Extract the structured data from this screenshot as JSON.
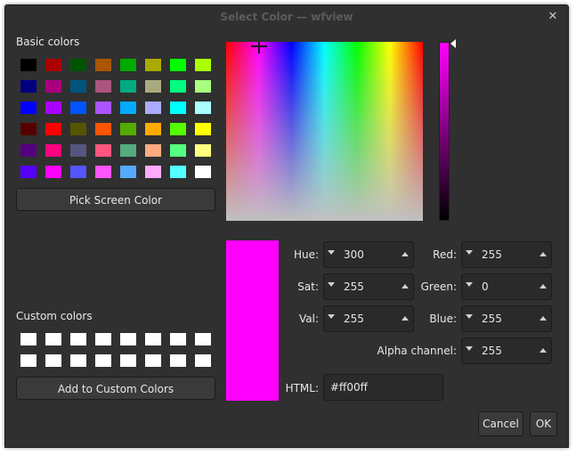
{
  "window": {
    "title": "Select Color — wfview",
    "close_glyph": "✕"
  },
  "basic_colors": {
    "label": "Basic colors",
    "swatches": [
      [
        "#000000",
        "#aa0000",
        "#005500",
        "#aa5500",
        "#00aa00",
        "#aaaa00",
        "#00ff00",
        "#aaff00"
      ],
      [
        "#00007f",
        "#aa007f",
        "#00557f",
        "#aa557f",
        "#00aa7f",
        "#aaaa7f",
        "#00ff7f",
        "#aaff7f"
      ],
      [
        "#0000ff",
        "#aa00ff",
        "#0055ff",
        "#aa55ff",
        "#00aaff",
        "#aaaaff",
        "#00ffff",
        "#aaffff"
      ],
      [
        "#550000",
        "#ff0000",
        "#555500",
        "#ff5500",
        "#55aa00",
        "#ffaa00",
        "#55ff00",
        "#ffff00"
      ],
      [
        "#55007f",
        "#ff007f",
        "#55557f",
        "#ff557f",
        "#55aa7f",
        "#ffaa7f",
        "#55ff7f",
        "#ffff7f"
      ],
      [
        "#5500ff",
        "#ff00ff",
        "#5555ff",
        "#ff55ff",
        "#55aaff",
        "#ffaaff",
        "#55ffff",
        "#ffffff"
      ]
    ]
  },
  "pick_screen_label": "Pick Screen Color",
  "custom_colors": {
    "label": "Custom colors",
    "rows": 2,
    "cols": 8,
    "color": "#ffffff"
  },
  "add_custom_label": "Add to Custom Colors",
  "current_color": "#ff00ff",
  "fields": {
    "hue": {
      "label": "Hue:",
      "value": "300"
    },
    "sat": {
      "label": "Sat:",
      "value": "255"
    },
    "val": {
      "label": "Val:",
      "value": "255"
    },
    "red": {
      "label": "Red:",
      "value": "255"
    },
    "green": {
      "label": "Green:",
      "value": "0"
    },
    "blue": {
      "label": "Blue:",
      "value": "255"
    },
    "alpha": {
      "label": "Alpha channel:",
      "value": "255"
    },
    "html": {
      "label": "HTML:",
      "value": "#ff00ff"
    }
  },
  "buttons": {
    "cancel": "Cancel",
    "ok": "OK"
  }
}
